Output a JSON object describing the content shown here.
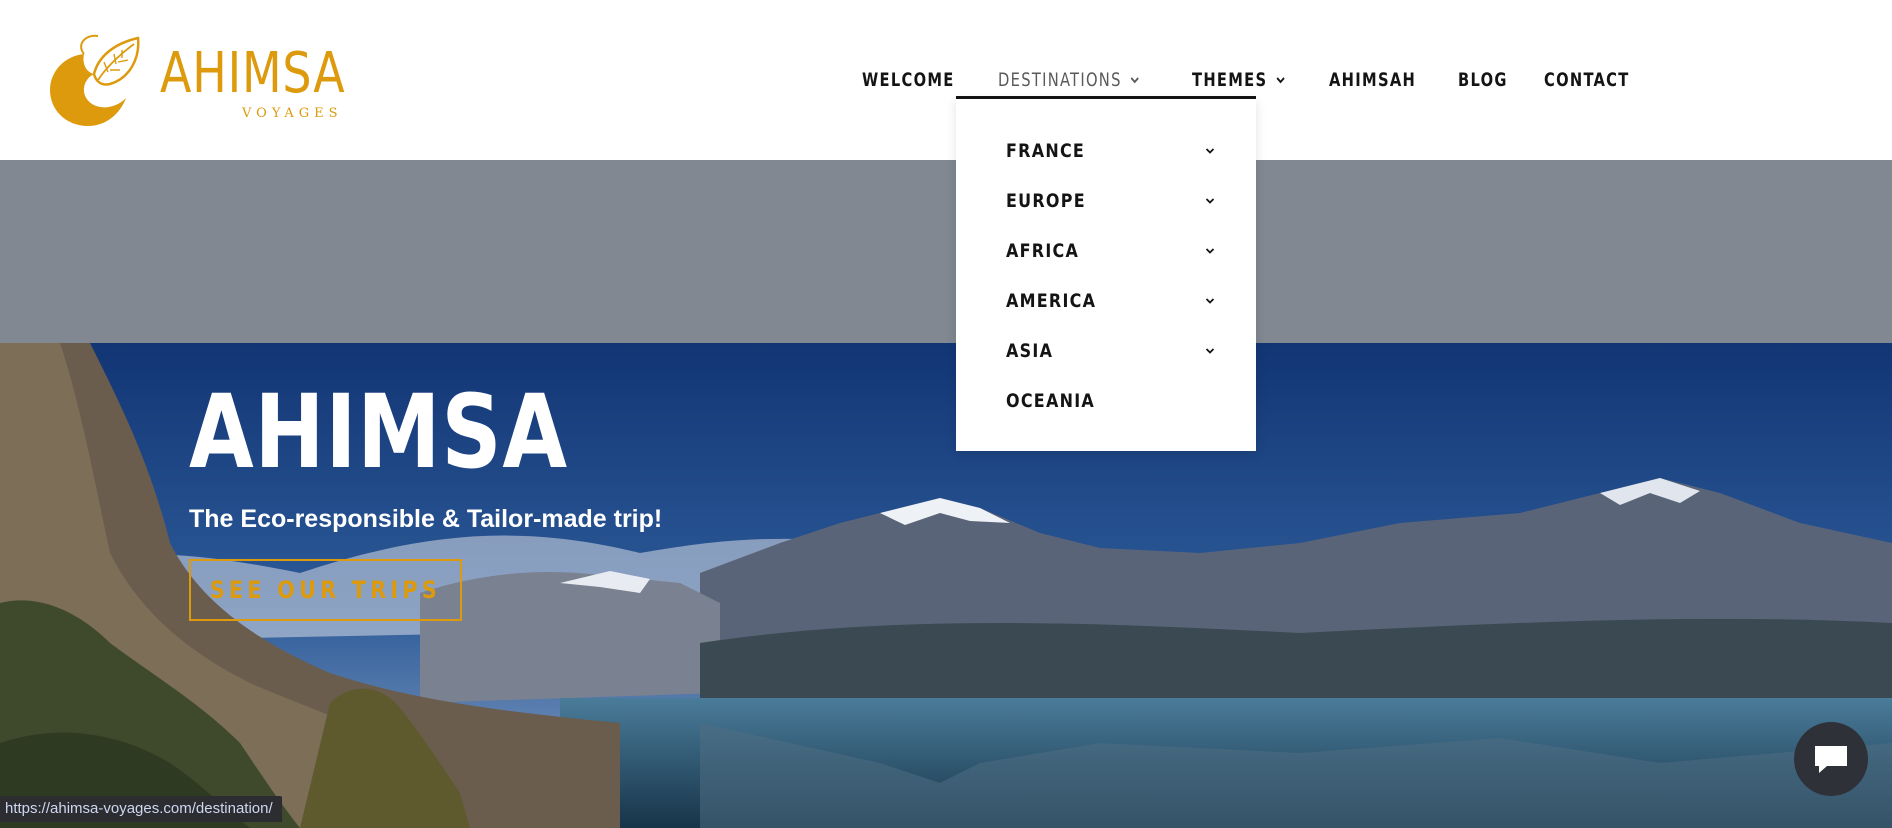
{
  "brand": {
    "name": "AHIMSA",
    "tagline": "VOYAGES",
    "color": "#dd9a0c"
  },
  "nav": {
    "items": [
      {
        "label": "WELCOME",
        "has_submenu": false
      },
      {
        "label": "DESTINATIONS",
        "has_submenu": true,
        "active": true
      },
      {
        "label": "THEMES",
        "has_submenu": true
      },
      {
        "label": "AHIMSAH",
        "has_submenu": false
      },
      {
        "label": "BLOG",
        "has_submenu": false
      },
      {
        "label": "CONTACT",
        "has_submenu": false
      }
    ]
  },
  "dropdown": {
    "items": [
      {
        "label": "FRANCE",
        "has_submenu": true
      },
      {
        "label": "EUROPE",
        "has_submenu": true
      },
      {
        "label": "AFRICA",
        "has_submenu": true
      },
      {
        "label": "AMERICA",
        "has_submenu": true
      },
      {
        "label": "ASIA",
        "has_submenu": true
      },
      {
        "label": "OCEANIA",
        "has_submenu": false
      }
    ]
  },
  "hero": {
    "title": "AHIMSA",
    "subtitle": "The Eco-responsible & Tailor-made trip!",
    "cta_label": "SEE OUR TRIPS"
  },
  "status_bar": {
    "url": "https://ahimsa-voyages.com/destination/"
  },
  "chat": {
    "icon": "chat-bubble-icon"
  },
  "colors": {
    "accent": "#dd9a0c",
    "band": "#818891",
    "text": "#141414"
  }
}
